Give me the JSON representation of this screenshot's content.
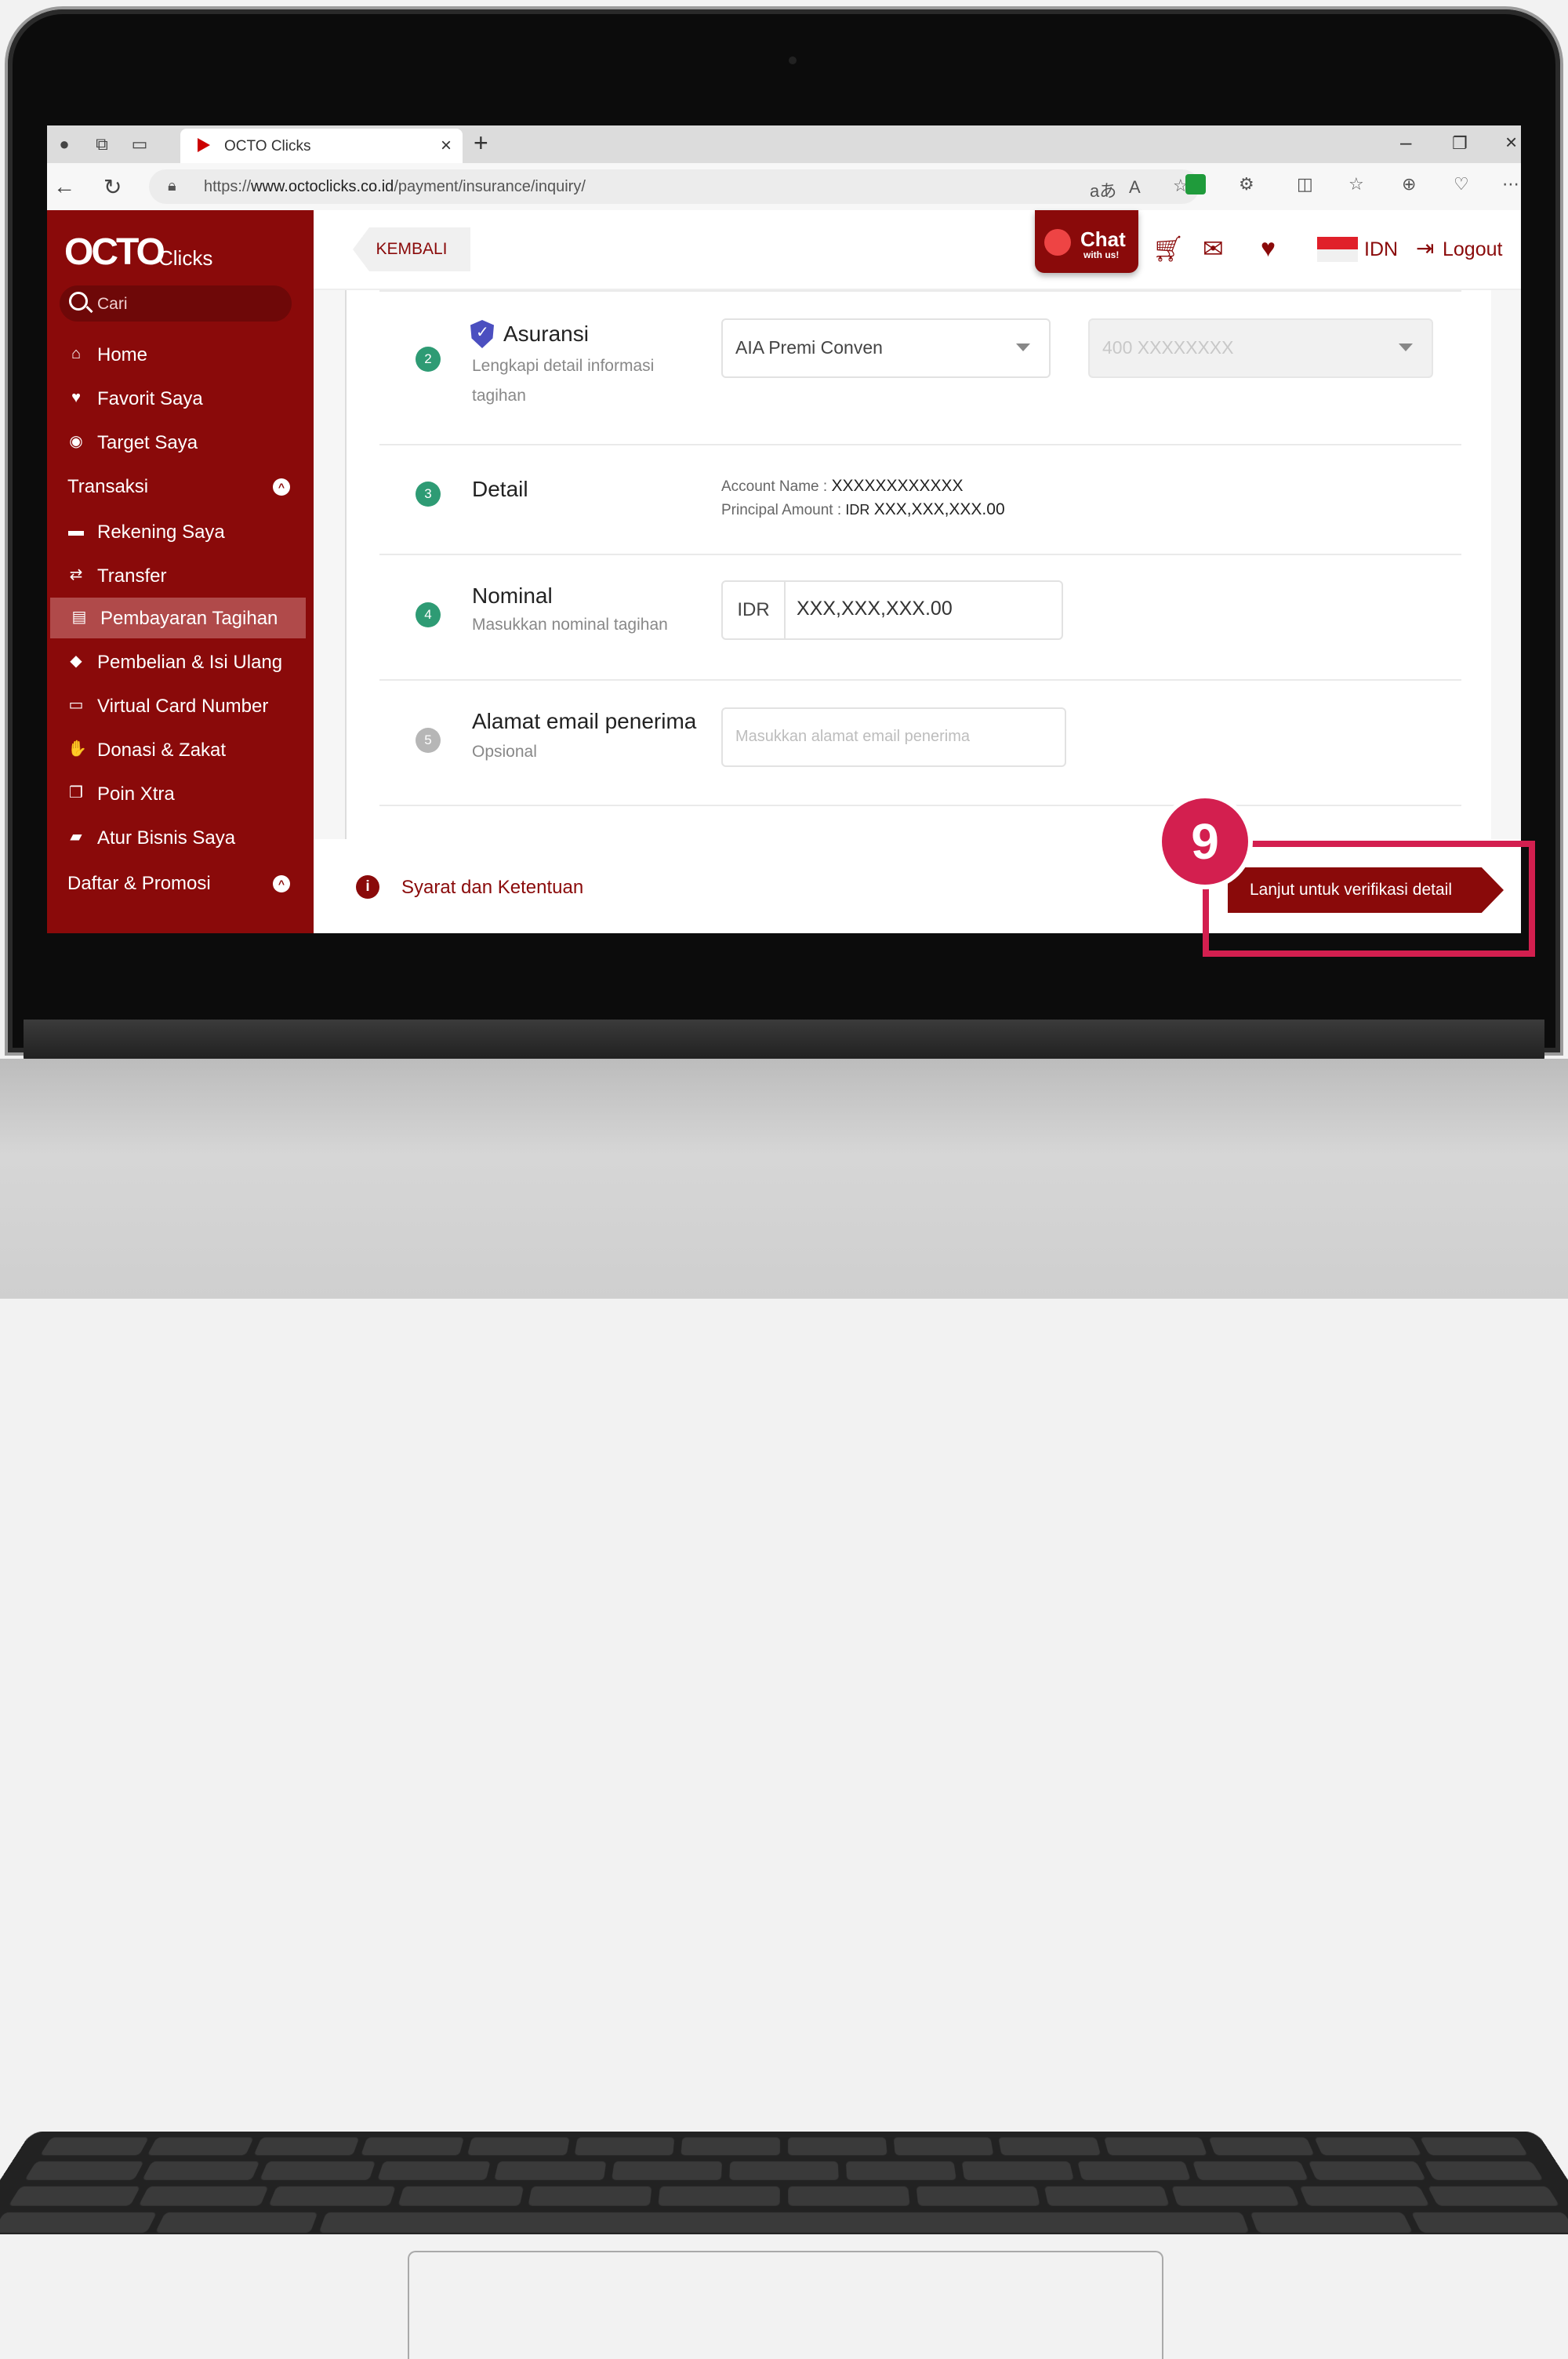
{
  "browser": {
    "tab_title": "OCTO Clicks",
    "url_prefix": "https://",
    "url_domain": "www.octoclicks.co.id",
    "url_path": "/payment/insurance/inquiry/"
  },
  "sidebar": {
    "logo": "OCTO",
    "logo_sub": "Clicks",
    "search_placeholder": "Cari",
    "items": [
      {
        "label": "Home",
        "icon": "home-icon"
      },
      {
        "label": "Favorit Saya",
        "icon": "heart-icon"
      },
      {
        "label": "Target Saya",
        "icon": "target-icon"
      },
      {
        "label": "Transaksi",
        "icon": "chevron-up-icon"
      },
      {
        "label": "Rekening Saya",
        "icon": "card-icon"
      },
      {
        "label": "Transfer",
        "icon": "transfer-icon"
      },
      {
        "label": "Pembayaran Tagihan",
        "icon": "bill-icon"
      },
      {
        "label": "Pembelian & Isi Ulang",
        "icon": "tag-icon"
      },
      {
        "label": "Virtual Card Number",
        "icon": "vcn-icon"
      },
      {
        "label": "Donasi & Zakat",
        "icon": "donation-icon"
      },
      {
        "label": "Poin Xtra",
        "icon": "gift-icon"
      },
      {
        "label": "Atur Bisnis Saya",
        "icon": "briefcase-icon"
      },
      {
        "label": "Daftar & Promosi",
        "icon": "chevron-up-icon"
      }
    ]
  },
  "header": {
    "back_label": "KEMBALI",
    "chat_title": "Chat",
    "chat_sub": "with us!",
    "language": "IDN",
    "logout_label": "Logout"
  },
  "form": {
    "step2": {
      "number": "2",
      "title": "Asuransi",
      "subtitle_1": "Lengkapi detail informasi",
      "subtitle_2": "tagihan",
      "provider_value": "AIA Premi Conven",
      "policy_value": "400 XXXXXXXX"
    },
    "step3": {
      "number": "3",
      "title": "Detail",
      "account_name_label": "Account Name :",
      "account_name_value": "XXXXXXXXXXXX",
      "principal_label": "Principal Amount :",
      "principal_currency": "IDR",
      "principal_value": "XXX,XXX,XXX.00"
    },
    "step4": {
      "number": "4",
      "title": "Nominal",
      "subtitle": "Masukkan nominal tagihan",
      "currency": "IDR",
      "amount": "XXX,XXX,XXX.00"
    },
    "step5": {
      "number": "5",
      "title": "Alamat email penerima",
      "subtitle": "Opsional",
      "placeholder": "Masukkan alamat email penerima"
    }
  },
  "footer": {
    "terms_label": "Syarat dan Ketentuan",
    "continue_label": "Lanjut untuk verifikasi detail"
  },
  "annotation": {
    "step_badge": "9",
    "color": "#d31f4f"
  },
  "colors": {
    "brand": "#8a0a0a",
    "step_green": "#2e9b74"
  }
}
